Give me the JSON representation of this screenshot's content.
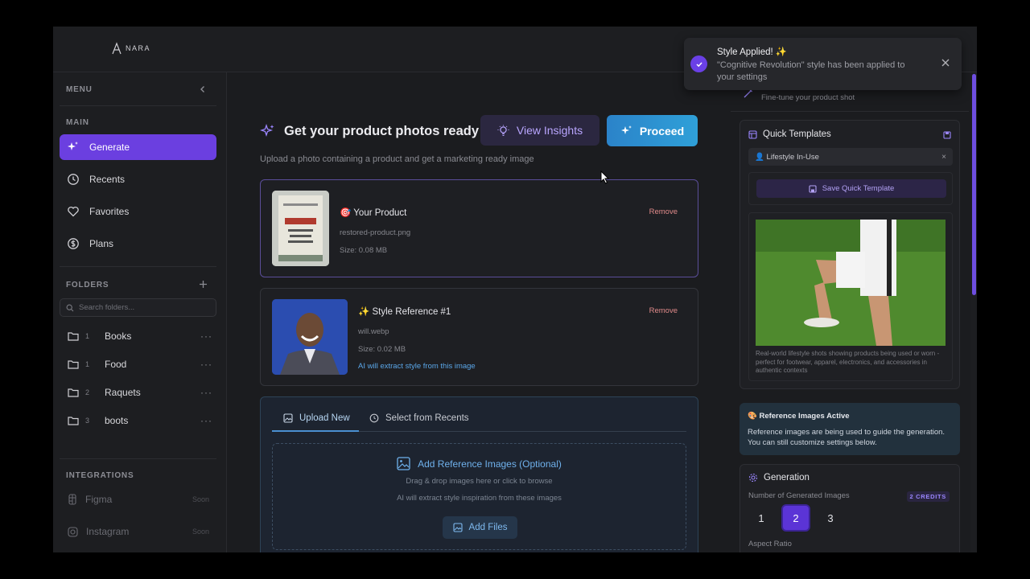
{
  "app": {
    "logo_text": "NARA"
  },
  "sidebar": {
    "menu_label": "MENU",
    "main_label": "MAIN",
    "nav": [
      {
        "label": "Generate",
        "icon": "sparkles-icon"
      },
      {
        "label": "Recents",
        "icon": "clock-icon"
      },
      {
        "label": "Favorites",
        "icon": "heart-icon"
      },
      {
        "label": "Plans",
        "icon": "dollar-icon"
      }
    ],
    "folders_label": "FOLDERS",
    "folder_search_placeholder": "Search folders...",
    "folders": [
      {
        "count": "1",
        "name": "Books"
      },
      {
        "count": "1",
        "name": "Food"
      },
      {
        "count": "2",
        "name": "Raquets"
      },
      {
        "count": "3",
        "name": "boots"
      }
    ],
    "integrations_label": "INTEGRATIONS",
    "integrations": [
      {
        "name": "Figma",
        "status": "Soon"
      },
      {
        "name": "Instagram",
        "status": "Soon"
      }
    ]
  },
  "main": {
    "title": "Get your product photos ready",
    "subtitle": "Upload a photo containing a product and get a marketing ready image",
    "insights_label": "View Insights",
    "proceed_label": "Proceed",
    "product_card": {
      "title": "🎯 Your Product",
      "filename": "restored-product.png",
      "size": "Size: 0.08 MB",
      "remove_label": "Remove"
    },
    "style_card": {
      "title": "✨ Style Reference #1",
      "filename": "will.webp",
      "size": "Size: 0.02 MB",
      "ai_note": "AI will extract style from this image",
      "remove_label": "Remove"
    },
    "upload": {
      "tab_upload": "Upload New",
      "tab_recents": "Select from Recents",
      "dz_title": "Add Reference Images (Optional)",
      "dz_line1": "Drag & drop images here or click to browse",
      "dz_line2": "AI will extract style inspiration from these images",
      "add_files_label": "Add Files"
    }
  },
  "right": {
    "header_sub": "Fine-tune your product shot",
    "quick_templates_title": "Quick Templates",
    "chip_label": "👤 Lifestyle In-Use",
    "chip_close": "×",
    "save_template_label": "Save Quick Template",
    "template_desc": "Real-world lifestyle shots showing products being used or worn - perfect for footwear, apparel, electronics, and accessories in authentic contexts",
    "ref_title": "🎨 Reference Images Active",
    "ref_body": "Reference images are being used to guide the generation. You can still customize settings below.",
    "generation_title": "Generation",
    "num_images_label": "Number of Generated Images",
    "credits_label": "2 CREDITS",
    "count_options": [
      "1",
      "2",
      "3"
    ],
    "selected_count": "2",
    "aspect_label": "Aspect Ratio"
  },
  "toast": {
    "title": "Style Applied! ✨",
    "message": "\"Cognitive Revolution\" style has been applied to your settings"
  },
  "colors": {
    "accent": "#6b3fe0",
    "proceed": "#2fa0d8",
    "link": "#5aa6e8",
    "remove": "#e08a8a"
  }
}
